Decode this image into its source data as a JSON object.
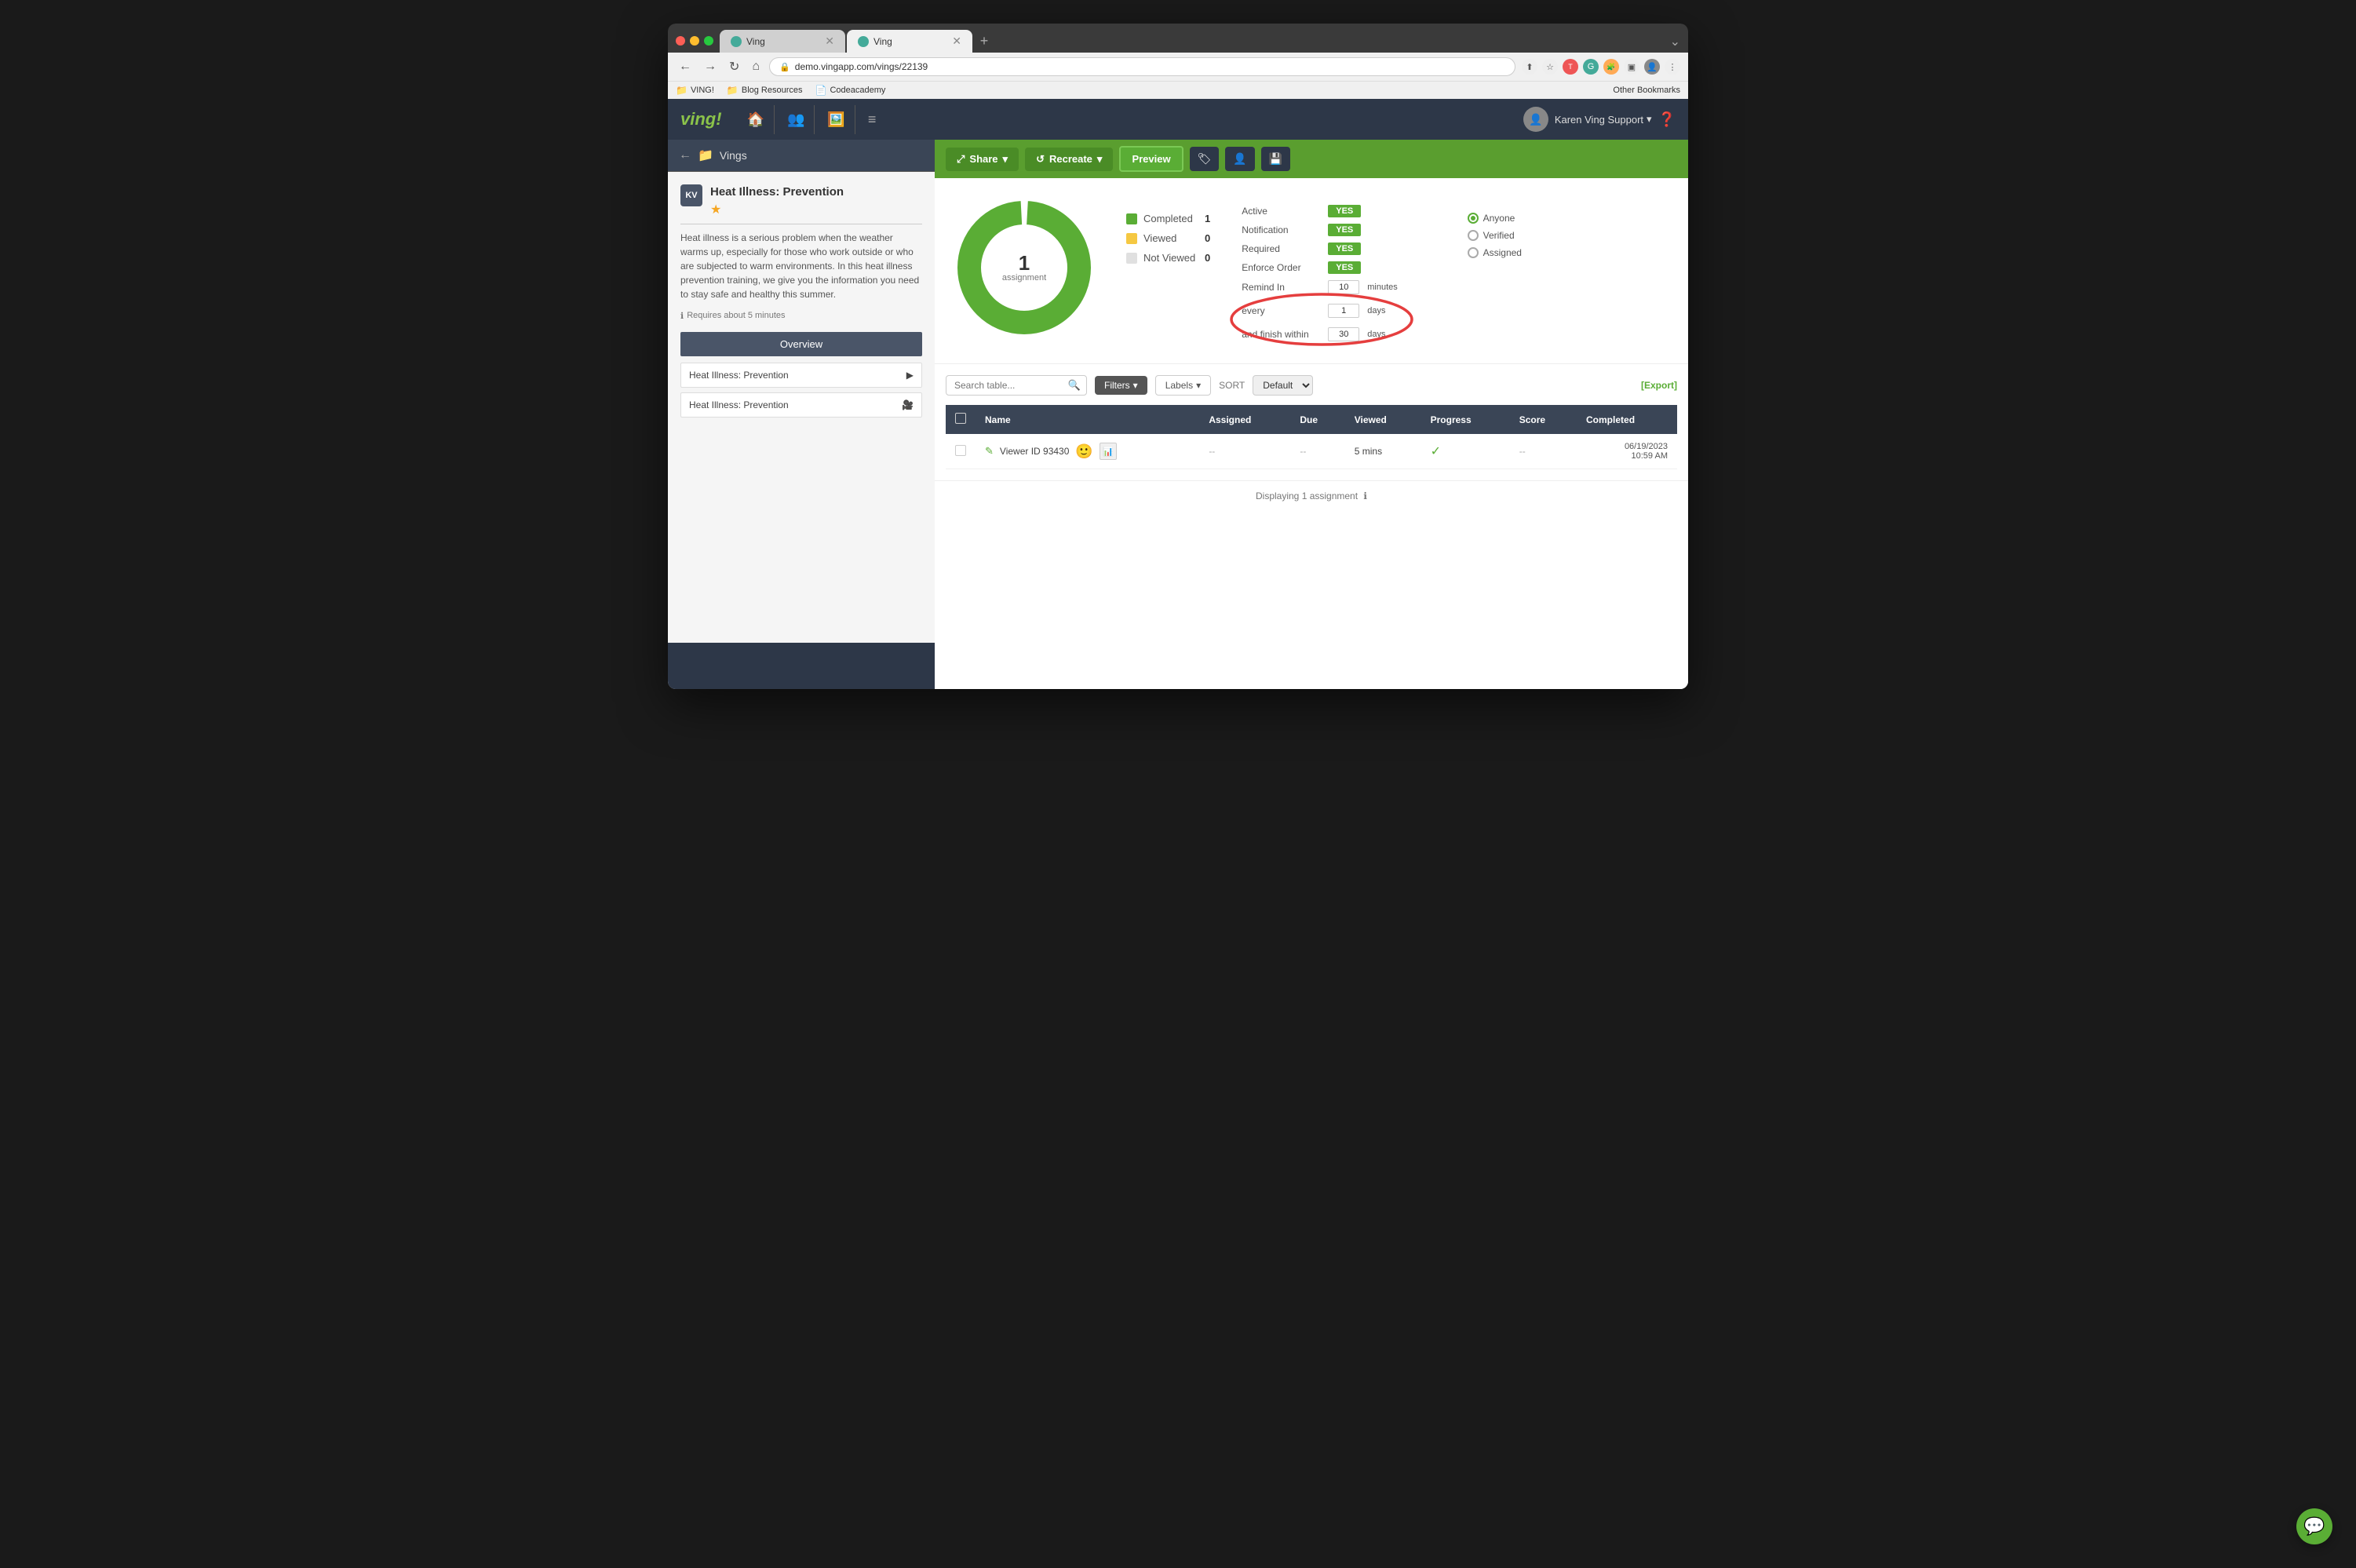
{
  "browser": {
    "tabs": [
      {
        "label": "Ving",
        "active": false
      },
      {
        "label": "Ving",
        "active": true
      }
    ],
    "url": "demo.vingapp.com/vings/22139",
    "bookmarks": [
      {
        "label": "VING!",
        "icon": "📁"
      },
      {
        "label": "Blog Resources",
        "icon": "📁"
      },
      {
        "label": "Codeacademy",
        "icon": "📄"
      }
    ],
    "bookmarks_right": "Other Bookmarks"
  },
  "topnav": {
    "logo": "ving!",
    "user": "Karen Ving Support",
    "icons": [
      "🏠",
      "👥",
      "🖼️",
      "≡"
    ]
  },
  "sidebar": {
    "header": "Vings",
    "avatar_initials": "KV",
    "ving_title": "Heat Illness: Prevention",
    "description": "Heat illness is a serious problem when the weather warms up, especially for those who work outside or who are subjected to warm environments. In this heat illness prevention training, we give you the information you need to stay safe and healthy this summer.",
    "time_required": "Requires about 5 minutes",
    "overview_btn": "Overview",
    "items": [
      {
        "label": "Heat Illness: Prevention"
      },
      {
        "label": "Heat Illness: Prevention"
      }
    ]
  },
  "action_bar": {
    "share_label": "Share",
    "recreate_label": "Recreate",
    "preview_label": "Preview"
  },
  "stats": {
    "donut": {
      "center_number": "1",
      "center_label": "assignment"
    },
    "legend": [
      {
        "label": "Completed",
        "value": "1",
        "color": "#5aad35"
      },
      {
        "label": "Viewed",
        "value": "0",
        "color": "#f5c842"
      },
      {
        "label": "Not Viewed",
        "value": "0",
        "color": "#e0e0e0"
      }
    ],
    "settings": [
      {
        "label": "Active",
        "value": "YES"
      },
      {
        "label": "Notification",
        "value": "YES"
      },
      {
        "label": "Required",
        "value": "YES"
      },
      {
        "label": "Enforce Order",
        "value": "YES"
      }
    ],
    "remind_label": "Remind In",
    "remind_minutes": "10",
    "remind_unit": "minutes",
    "every_label": "every",
    "every_days": "1",
    "every_unit": "days",
    "finish_label": "and finish within",
    "finish_days": "30",
    "finish_unit": "days",
    "radio_options": [
      {
        "label": "Anyone",
        "selected": true
      },
      {
        "label": "Verified",
        "selected": false
      },
      {
        "label": "Assigned",
        "selected": false
      }
    ]
  },
  "table": {
    "search_placeholder": "Search table...",
    "filters_label": "Filters",
    "labels_label": "Labels",
    "sort_label": "SORT",
    "sort_default": "Default",
    "export_label": "[Export]",
    "columns": [
      "Name",
      "Assigned",
      "Due",
      "Viewed",
      "Progress",
      "Score",
      "Completed"
    ],
    "rows": [
      {
        "name": "Viewer ID 93430",
        "assigned": "--",
        "due": "--",
        "viewed": "5 mins",
        "progress": "✓",
        "score": "--",
        "completed": "06/19/2023\n10:59 AM"
      }
    ],
    "footer": "Displaying 1 assignment"
  }
}
